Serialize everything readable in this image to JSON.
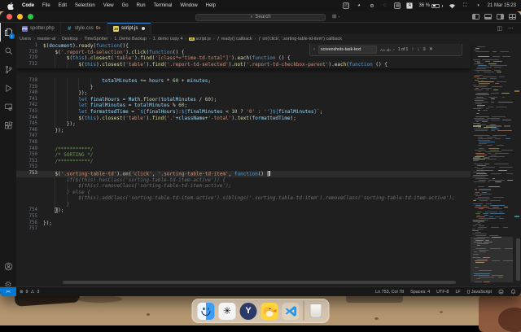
{
  "menu_bar": {
    "items": [
      "Code",
      "File",
      "Edit",
      "Selection",
      "View",
      "Go",
      "Run",
      "Terminal",
      "Window",
      "Help"
    ],
    "battery_pct": "36 %",
    "clock": "21 Mar 15:23"
  },
  "title_bar": {
    "search_label": "Search"
  },
  "tabs": [
    {
      "label": "spotter.php",
      "icon": "php",
      "active": false,
      "badge": "",
      "modified": false
    },
    {
      "label": "style.css",
      "icon": "css",
      "active": false,
      "badge": "9+",
      "modified": false
    },
    {
      "label": "script.js",
      "icon": "js",
      "active": true,
      "badge": "",
      "modified": true
    }
  ],
  "breadcrumb": [
    {
      "t": "Users"
    },
    {
      "t": "master-al"
    },
    {
      "t": "Desktop"
    },
    {
      "t": "TimeSpotter"
    },
    {
      "t": "1. Demo Backup"
    },
    {
      "t": "1. demo copy 4"
    },
    {
      "t": "script.js",
      "icon": "js"
    },
    {
      "t": "ready() callback",
      "icon": "fn"
    },
    {
      "t": "on('click', '.sorting-table-td-item') callback",
      "icon": "fn"
    }
  ],
  "find": {
    "query": "screenshots-task-text",
    "toggles": [
      "Aa",
      "ab",
      ".*"
    ],
    "count": "1 of 1"
  },
  "editor": {
    "sticky_lines": [
      {
        "num": "1",
        "ind": 0,
        "tokens": [
          [
            "f",
            "$"
          ],
          [
            "p",
            "("
          ],
          [
            "v",
            "document"
          ],
          [
            "p",
            ")."
          ],
          [
            "f",
            "ready"
          ],
          [
            "p",
            "("
          ],
          [
            "k",
            "function"
          ],
          [
            "p",
            "(){"
          ]
        ]
      },
      {
        "num": "710",
        "ind": 4,
        "tokens": [
          [
            "f",
            "$"
          ],
          [
            "p",
            "("
          ],
          [
            "s",
            "'.report-td-selection'"
          ],
          [
            "p",
            ")."
          ],
          [
            "f",
            "click"
          ],
          [
            "p",
            "("
          ],
          [
            "k",
            "function"
          ],
          [
            "p",
            "() {"
          ]
        ]
      },
      {
        "num": "729",
        "ind": 8,
        "tokens": [
          [
            "f",
            "$"
          ],
          [
            "p",
            "("
          ],
          [
            "k",
            "this"
          ],
          [
            "p",
            ")."
          ],
          [
            "f",
            "closest"
          ],
          [
            "p",
            "("
          ],
          [
            "s",
            "'table'"
          ],
          [
            "p",
            ")."
          ],
          [
            "f",
            "find"
          ],
          [
            "p",
            "("
          ],
          [
            "s",
            "'[class*=\"time-td-total\"]'"
          ],
          [
            "p",
            ")."
          ],
          [
            "f",
            "each"
          ],
          [
            "p",
            "("
          ],
          [
            "k",
            "function"
          ],
          [
            "p",
            " () {"
          ]
        ]
      },
      {
        "num": "732",
        "ind": 12,
        "tokens": [
          [
            "f",
            "$"
          ],
          [
            "p",
            "("
          ],
          [
            "k",
            "this"
          ],
          [
            "p",
            ")."
          ],
          [
            "f",
            "closest"
          ],
          [
            "p",
            "("
          ],
          [
            "s",
            "'table'"
          ],
          [
            "p",
            ")."
          ],
          [
            "f",
            "find"
          ],
          [
            "p",
            "("
          ],
          [
            "s",
            "'.report-td-selected'"
          ],
          [
            "p",
            ")."
          ],
          [
            "f",
            "not"
          ],
          [
            "p",
            "("
          ],
          [
            "s",
            "'.report-td-checkbox-parent'"
          ],
          [
            "p",
            ")."
          ],
          [
            "f",
            "each"
          ],
          [
            "p",
            "("
          ],
          [
            "k",
            "function"
          ],
          [
            "p",
            " () {"
          ]
        ]
      }
    ],
    "lines": [
      {
        "num": "738",
        "ind": 20,
        "tokens": [
          [
            "v",
            "totalMinutes"
          ],
          [
            "p",
            " += "
          ],
          [
            "v",
            "hours"
          ],
          [
            "p",
            " * "
          ],
          [
            "n",
            "60"
          ],
          [
            "p",
            " + "
          ],
          [
            "v",
            "minutes"
          ],
          [
            "p",
            ";"
          ]
        ]
      },
      {
        "num": "739",
        "ind": 16,
        "tokens": [
          [
            "p",
            "}"
          ]
        ]
      },
      {
        "num": "740",
        "ind": 12,
        "tokens": [
          [
            "p",
            "});"
          ]
        ]
      },
      {
        "num": "741",
        "ind": 12,
        "tokens": [
          [
            "k",
            "let"
          ],
          [
            "p",
            " "
          ],
          [
            "v",
            "finalHours"
          ],
          [
            "p",
            " = "
          ],
          [
            "v",
            "Math"
          ],
          [
            "p",
            "."
          ],
          [
            "f",
            "floor"
          ],
          [
            "p",
            "("
          ],
          [
            "v",
            "totalMinutes"
          ],
          [
            "p",
            " / "
          ],
          [
            "n",
            "60"
          ],
          [
            "p",
            ");"
          ]
        ]
      },
      {
        "num": "742",
        "ind": 12,
        "tokens": [
          [
            "k",
            "let"
          ],
          [
            "p",
            " "
          ],
          [
            "v",
            "finalMinutes"
          ],
          [
            "p",
            " = "
          ],
          [
            "v",
            "totalMinutes"
          ],
          [
            "p",
            " % "
          ],
          [
            "n",
            "60"
          ],
          [
            "p",
            ";"
          ]
        ]
      },
      {
        "num": "743",
        "ind": 12,
        "tokens": [
          [
            "k",
            "let"
          ],
          [
            "p",
            " "
          ],
          [
            "v",
            "formattedTime"
          ],
          [
            "p",
            " = "
          ],
          [
            "s",
            "`"
          ],
          [
            "t",
            "${"
          ],
          [
            "v",
            "finalHours"
          ],
          [
            "t",
            "}"
          ],
          [
            "s",
            ":"
          ],
          [
            "t",
            "${"
          ],
          [
            "v",
            "finalMinutes"
          ],
          [
            "p",
            " < "
          ],
          [
            "n",
            "10"
          ],
          [
            "p",
            " ? "
          ],
          [
            "s",
            "'0'"
          ],
          [
            "p",
            " : "
          ],
          [
            "s",
            "''"
          ],
          [
            "t",
            "}"
          ],
          [
            "t",
            "${"
          ],
          [
            "v",
            "finalMinutes"
          ],
          [
            "t",
            "}"
          ],
          [
            "s",
            "`"
          ],
          [
            "p",
            ";"
          ]
        ]
      },
      {
        "num": "744",
        "ind": 12,
        "tokens": [
          [
            "f",
            "$"
          ],
          [
            "p",
            "("
          ],
          [
            "k",
            "this"
          ],
          [
            "p",
            ")."
          ],
          [
            "f",
            "closest"
          ],
          [
            "p",
            "("
          ],
          [
            "s",
            "'table'"
          ],
          [
            "p",
            ")."
          ],
          [
            "f",
            "find"
          ],
          [
            "p",
            "("
          ],
          [
            "s",
            "'.'"
          ],
          [
            "p",
            "+"
          ],
          [
            "v",
            "className"
          ],
          [
            "p",
            "+"
          ],
          [
            "s",
            "'-total'"
          ],
          [
            "p",
            ")."
          ],
          [
            "f",
            "text"
          ],
          [
            "p",
            "("
          ],
          [
            "v",
            "formattedTime"
          ],
          [
            "p",
            ");"
          ]
        ]
      },
      {
        "num": "745",
        "ind": 8,
        "tokens": [
          [
            "p",
            "});"
          ]
        ]
      },
      {
        "num": "746",
        "ind": 4,
        "tokens": [
          [
            "p",
            "});"
          ]
        ]
      },
      {
        "num": "747",
        "ind": 0,
        "tokens": []
      },
      {
        "num": "748",
        "ind": 0,
        "tokens": []
      },
      {
        "num": "749",
        "ind": 4,
        "tokens": [
          [
            "c",
            "/***********/"
          ]
        ]
      },
      {
        "num": "750",
        "ind": 4,
        "tokens": [
          [
            "c",
            "/* SORTING */"
          ]
        ]
      },
      {
        "num": "751",
        "ind": 4,
        "tokens": [
          [
            "c",
            "/***********/"
          ]
        ]
      },
      {
        "num": "752",
        "ind": 0,
        "tokens": []
      },
      {
        "num": "753",
        "ind": 4,
        "current": true,
        "tokens": [
          [
            "f",
            "$"
          ],
          [
            "p",
            "("
          ],
          [
            "s",
            "'.sorting-table-td'"
          ],
          [
            "p",
            ")."
          ],
          [
            "f",
            "on"
          ],
          [
            "p",
            "("
          ],
          [
            "s",
            "'click'"
          ],
          [
            "p",
            ", "
          ],
          [
            "s",
            "'.sorting-table-td-item'"
          ],
          [
            "p",
            ", "
          ],
          [
            "k",
            "function"
          ],
          [
            "p",
            "() "
          ],
          [
            "b",
            "{"
          ],
          [
            "cur",
            ""
          ]
        ]
      },
      {
        "num": "",
        "ind": 8,
        "tokens": [
          [
            "g",
            "if($(this).hasClass('sorting-table-td-item-active')) {"
          ]
        ]
      },
      {
        "num": "",
        "ind": 12,
        "tokens": [
          [
            "g",
            "$(this).removeClass('sorting-table-td-item-active');"
          ]
        ]
      },
      {
        "num": "",
        "ind": 8,
        "tokens": [
          [
            "g",
            "} else {"
          ]
        ]
      },
      {
        "num": "",
        "ind": 12,
        "tokens": [
          [
            "g",
            "$(this).addClass('sorting-table-td-item-active').siblings('.sorting-table-td-item').removeClass('sorting-table-td-item-active');"
          ]
        ]
      },
      {
        "num": "",
        "ind": 8,
        "tokens": [
          [
            "g",
            "}"
          ]
        ]
      },
      {
        "num": "754",
        "ind": 4,
        "tokens": [
          [
            "b",
            "}"
          ],
          [
            "p",
            ");"
          ]
        ]
      },
      {
        "num": "755",
        "ind": 0,
        "tokens": []
      },
      {
        "num": "756",
        "ind": 0,
        "tokens": [
          [
            "p",
            "});"
          ]
        ]
      },
      {
        "num": "757",
        "ind": 0,
        "tokens": []
      }
    ]
  },
  "status_bar": {
    "errors": "9",
    "warnings": "3",
    "items": [
      "Ln 753, Col 78",
      "Spaces: 4",
      "UTF-8",
      "LF",
      "{} JavaScript"
    ]
  },
  "colors": {
    "accent_blue": "#0078d4",
    "tab_modified_badge": "#e2c08d",
    "editor_bg": "#1f1f1f"
  },
  "dock_apps": [
    "finder",
    "chatgpt",
    "yandex",
    "duck",
    "vscode",
    "trash"
  ]
}
